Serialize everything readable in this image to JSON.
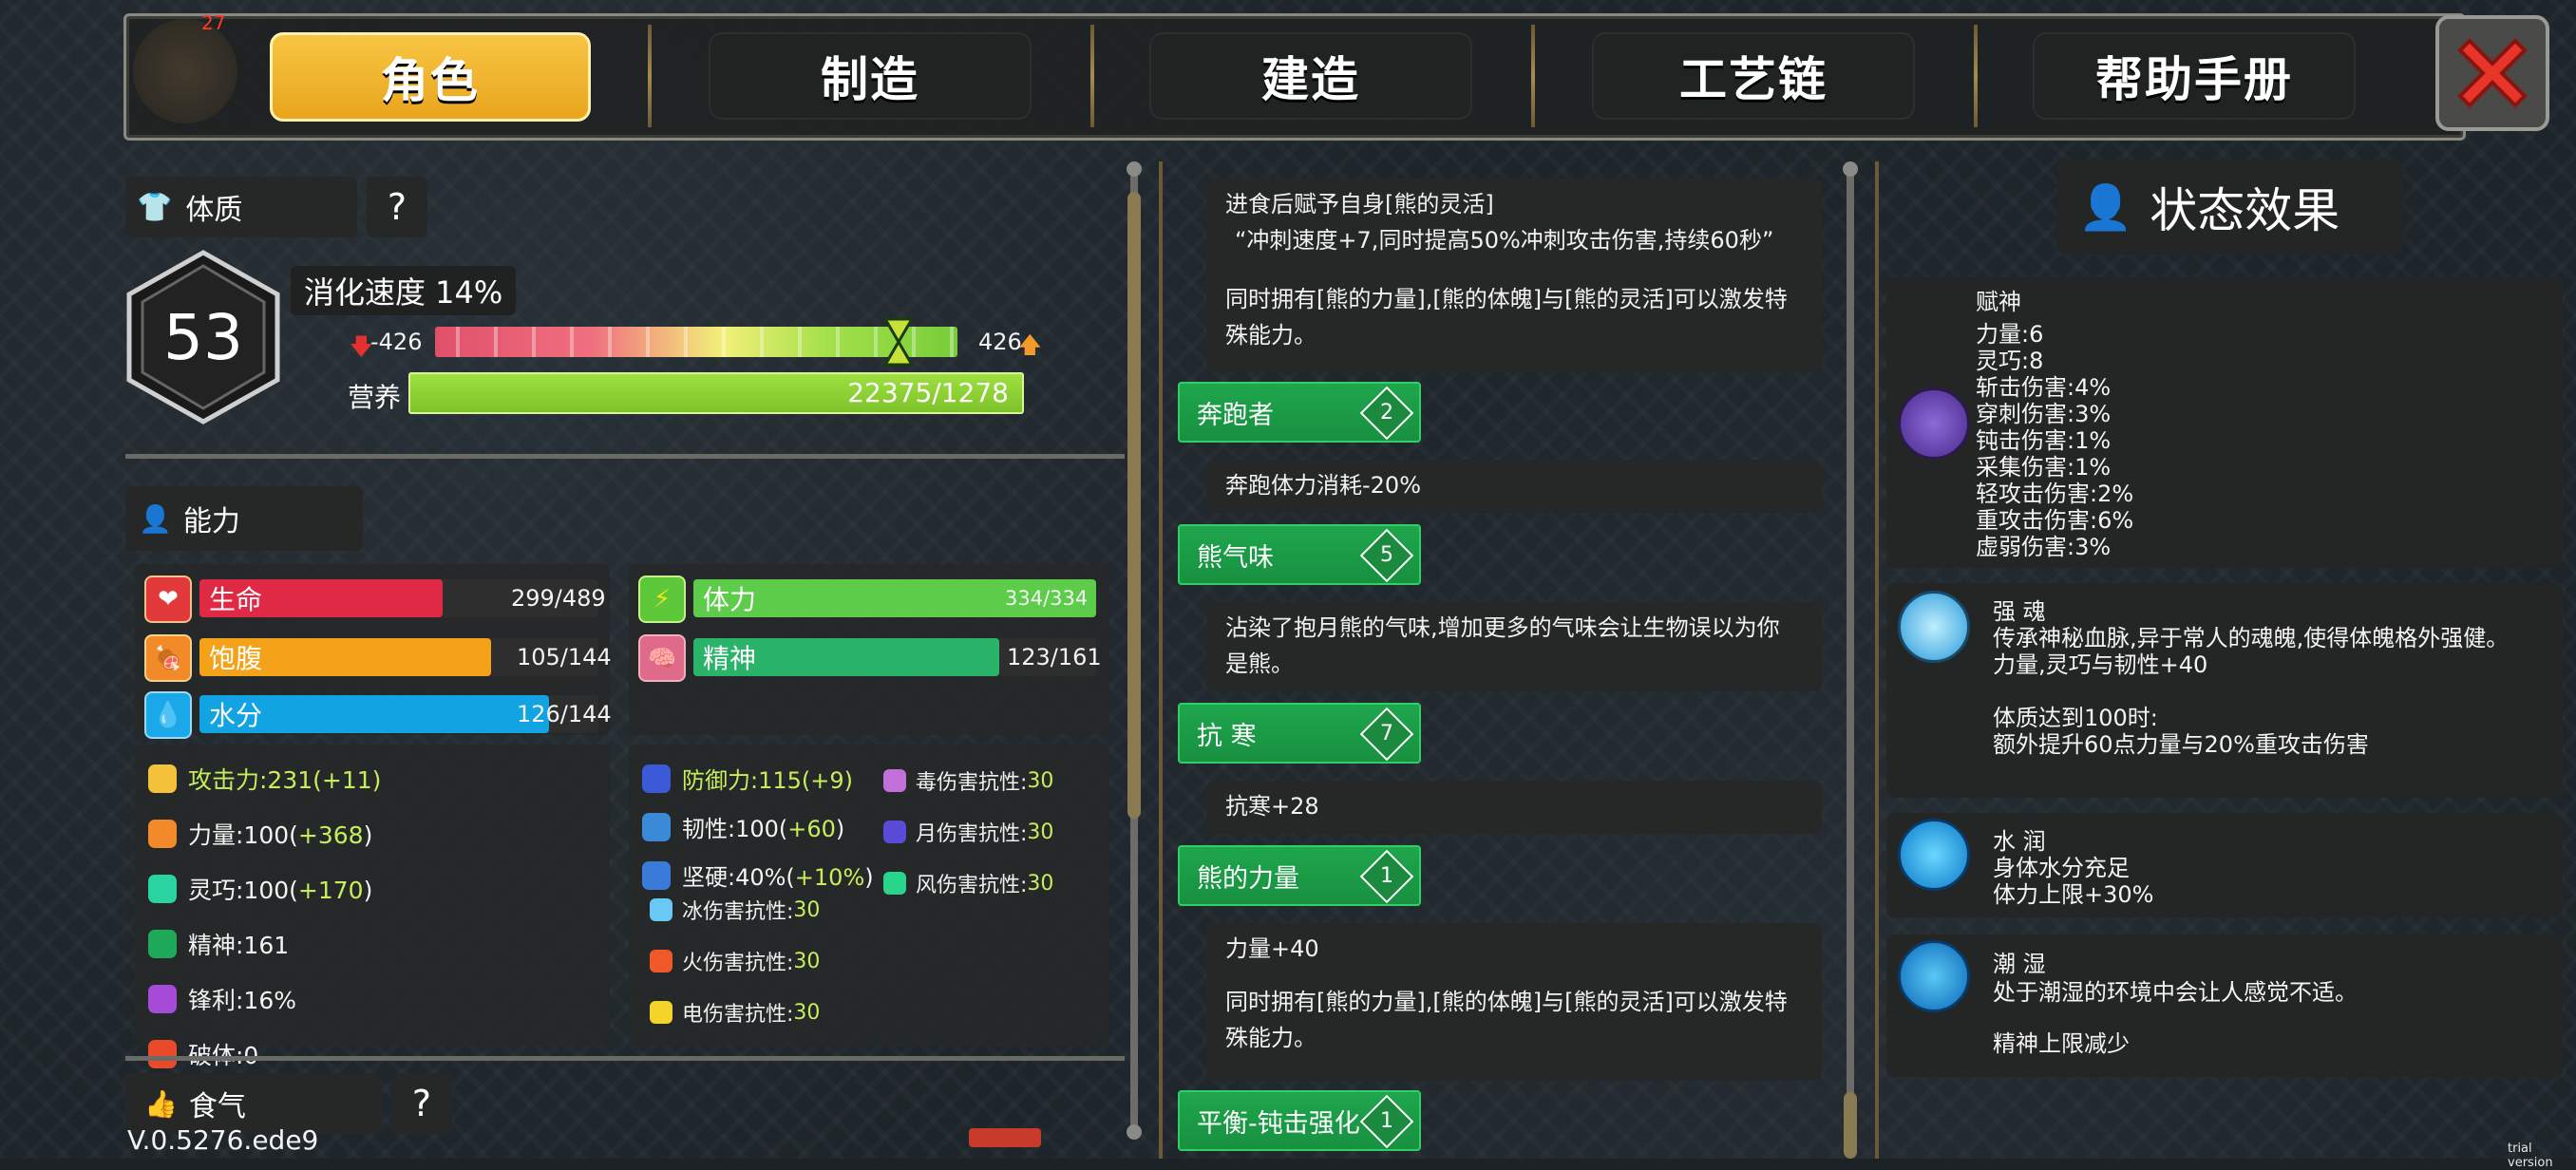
{
  "top": {
    "badge": "27",
    "tabs": [
      "角色",
      "制造",
      "建造",
      "工艺链",
      "帮助手册"
    ]
  },
  "left": {
    "constitution": {
      "header": "体质",
      "help": "?",
      "level": "53"
    },
    "digest": {
      "label": "消化速度 14%",
      "low": "-426",
      "high": "426"
    },
    "nutrition": {
      "label": "营养",
      "value": "22375/1278"
    },
    "ability_header": "能力",
    "bars": {
      "hp": {
        "label": "生命",
        "value": "299/489",
        "fill": 0.61
      },
      "satiety": {
        "label": "饱腹",
        "value": "105/144",
        "fill": 0.73
      },
      "water": {
        "label": "水分",
        "value": "126/144",
        "fill": 0.875
      },
      "stamina": {
        "label": "体力",
        "value": "334/334",
        "fill": 1.0
      },
      "spirit": {
        "label": "精神",
        "value": "123/161",
        "fill": 0.76
      }
    },
    "stats_left": [
      {
        "label": "攻击力:231(+11)"
      },
      {
        "label": "力量:100(",
        "extra": "+368",
        "close": ")"
      },
      {
        "label": "灵巧:100(",
        "extra": "+170",
        "close": ")"
      },
      {
        "label": "精神:161"
      },
      {
        "label": "锋利:16%"
      },
      {
        "label": "破体:0"
      }
    ],
    "stats_right": [
      {
        "label": "防御力:115(+9)"
      },
      {
        "label": "韧性:100(",
        "extra": "+60",
        "close": ")"
      },
      {
        "label": "坚硬:40%(",
        "extra": "+10%",
        "close": ")"
      }
    ],
    "resist_col1": [
      {
        "label": "冰伤害抗性:",
        "value": "30"
      },
      {
        "label": "火伤害抗性:",
        "value": "30"
      },
      {
        "label": "电伤害抗性:",
        "value": "30"
      }
    ],
    "resist_col2": [
      {
        "label": "毒伤害抗性:",
        "value": "30"
      },
      {
        "label": "月伤害抗性:",
        "value": "30"
      },
      {
        "label": "风伤害抗性:",
        "value": "30"
      }
    ],
    "food_header": "食气",
    "food_help": "?",
    "version": "V.0.5276.ede9"
  },
  "middle": {
    "desc1": [
      "进食后赋予自身[熊的灵活]",
      "“冲刺速度+7,同时提高50%冲刺攻击伤害,持续60秒”",
      "",
      "同时拥有[熊的力量],[熊的体魄]与[熊的灵活]可以激发特",
      "殊能力。"
    ],
    "perks": [
      {
        "name": "奔跑者",
        "level": "2",
        "desc": [
          "奔跑体力消耗-20%"
        ]
      },
      {
        "name": "熊气味",
        "level": "5",
        "desc": [
          "沾染了抱月熊的气味,增加更多的气味会让生物误以为你",
          "是熊。"
        ]
      },
      {
        "name": "抗  寒",
        "level": "7",
        "desc": [
          "抗寒+28"
        ]
      },
      {
        "name": "熊的力量",
        "level": "1",
        "desc": [
          "力量+40",
          "",
          "同时拥有[熊的力量],[熊的体魄]与[熊的灵活]可以激发特",
          "殊能力。"
        ]
      },
      {
        "name": "平衡-钝击强化",
        "level": "1"
      }
    ]
  },
  "right": {
    "header": "状态效果",
    "effects": [
      {
        "title": "赋神",
        "lines": [
          "力量:6",
          "灵巧:8",
          "斩击伤害:4%",
          "穿刺伤害:3%",
          "钝击伤害:1%",
          "采集伤害:1%",
          "轻攻击伤害:2%",
          "重攻击伤害:6%",
          "虚弱伤害:3%"
        ]
      },
      {
        "title": "强 魂",
        "lines": [
          "传承神秘血脉,异于常人的魂魄,使得体魄格外强健。",
          "",
          "力量,灵巧与韧性+40",
          "",
          "体质达到100时:",
          "额外提升60点力量与20%重攻击伤害"
        ]
      },
      {
        "title": "水 润",
        "lines": [
          "身体水分充足",
          "体力上限+30%"
        ]
      },
      {
        "title": "潮 湿",
        "lines": [
          "处于潮湿的环境中会让人感觉不适。",
          "",
          "精神上限减少"
        ]
      }
    ],
    "trial": "trial version"
  }
}
